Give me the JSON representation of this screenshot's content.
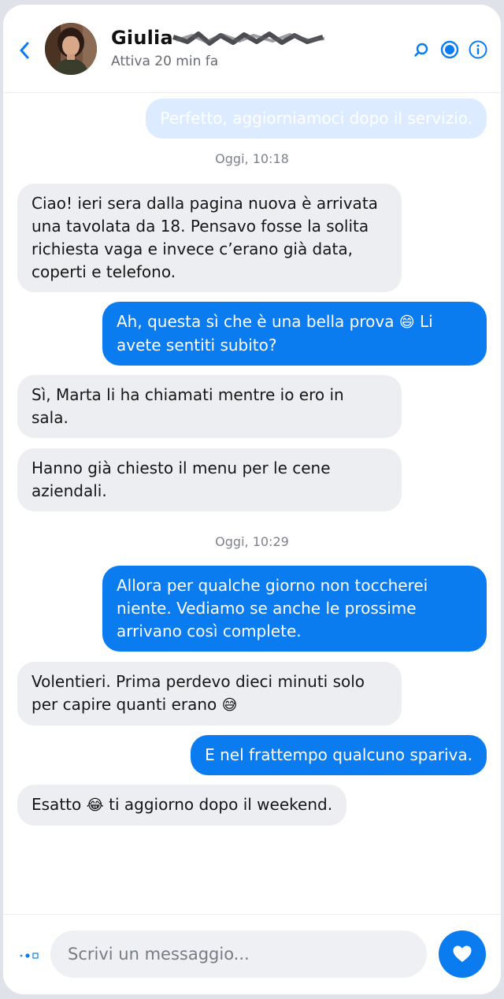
{
  "header": {
    "name": "Giulia",
    "status": "Attiva 20 min fa",
    "icons": [
      "chevron-left-icon",
      "search-icon",
      "record-icon",
      "info-icon"
    ]
  },
  "thread": {
    "previous_message": "Perfetto, aggiorniamoci dopo il servizio.",
    "timestamps": [
      "Oggi, 10:18",
      "Oggi, 10:29"
    ],
    "messages": [
      {
        "side": "in",
        "text": "Ciao! ieri sera dalla pagina nuova è arrivata\nuna tavolata da 18. Pensavo fosse la solita\nrichiesta vaga e invece c’erano già data,\ncoperti e telefono."
      },
      {
        "side": "out",
        "text": "Ah, questa sì che è una bella prova",
        "emoji": "😄",
        "text_after": " Li\navete sentiti subito?"
      },
      {
        "side": "in",
        "text": "Sì, Marta li ha chiamati mentre io ero in\nsala."
      },
      {
        "side": "in",
        "text": "Hanno già chiesto il menu per le cene\naziendali."
      },
      {
        "side": "out",
        "text": "Allora per qualche giorno non toccherei\nniente. Vediamo se anche le prossime\narrivano così complete."
      },
      {
        "side": "in",
        "text": "Volentieri. Prima perdevo dieci minuti solo\nper capire quanti erano",
        "emoji": "😅"
      },
      {
        "side": "out",
        "text": "E nel frattempo qualcuno spariva."
      },
      {
        "side": "in",
        "text": "Esatto",
        "emoji": "😂",
        "text_after": " ti aggiorno dopo il weekend."
      }
    ]
  },
  "composer": {
    "placeholder": "Scrivi un messaggio...",
    "icons": [
      "more-options-icon",
      "heart-icon"
    ]
  },
  "colors": {
    "accent": "#0a7cf0",
    "incoming_bubble": "#eceef1",
    "faded_bubble": "#dcebff"
  }
}
